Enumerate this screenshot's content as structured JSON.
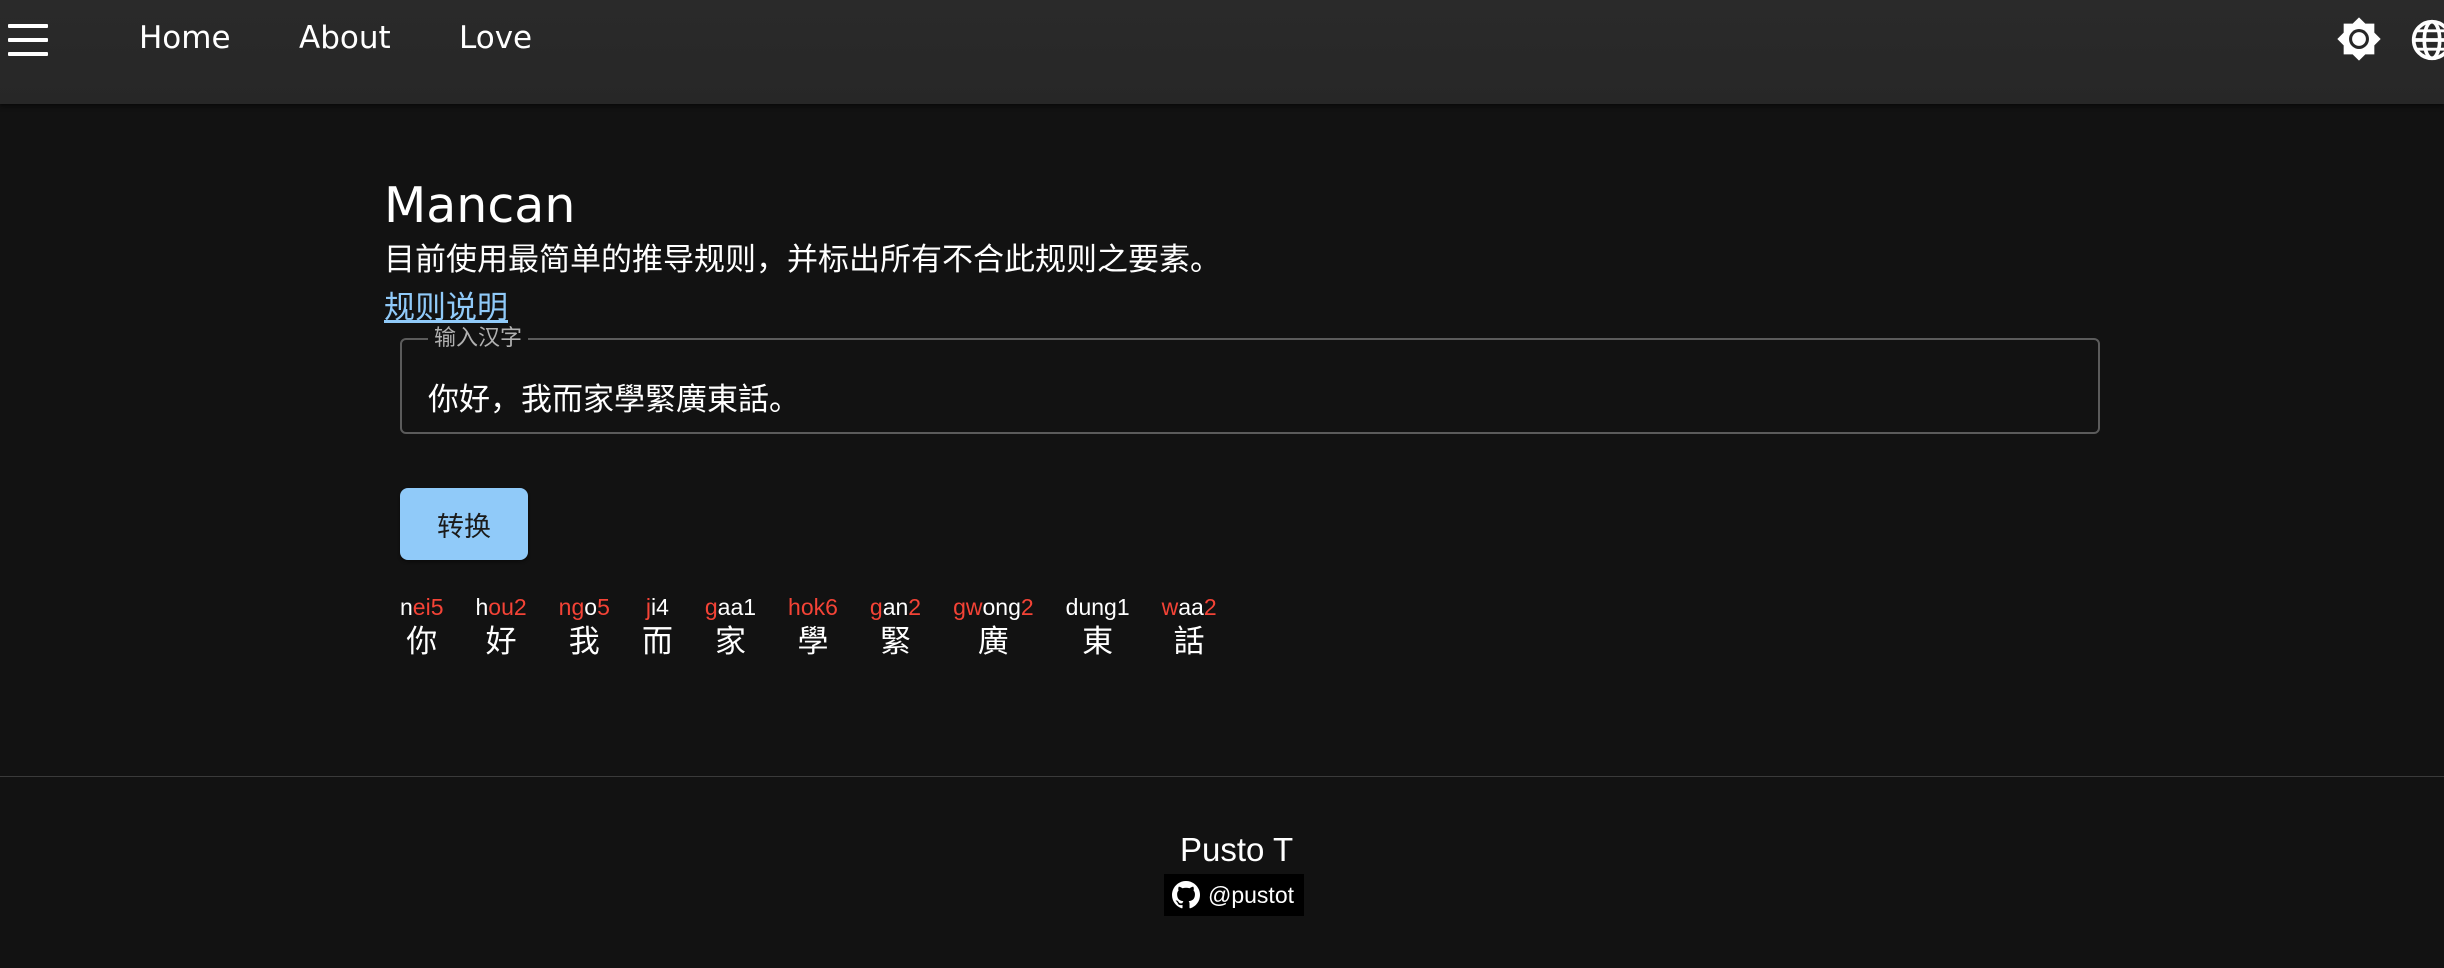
{
  "nav": {
    "items": [
      "Home",
      "About",
      "Love"
    ]
  },
  "icons": {
    "menu": "hamburger-menu-icon",
    "theme": "brightness-icon",
    "language": "globe-icon",
    "github": "github-icon"
  },
  "page": {
    "title": "Mancan",
    "description": "目前使用最简单的推导规则，并标出所有不合此规则之要素。",
    "rule_link": "规则说明"
  },
  "input": {
    "legend": "输入汉字",
    "value": "你好，我而家學緊廣東話。"
  },
  "convert_label": "转换",
  "result": [
    {
      "char": "你",
      "parts": [
        {
          "t": "n",
          "red": false
        },
        {
          "t": "ei5",
          "red": true
        }
      ]
    },
    {
      "char": "好",
      "parts": [
        {
          "t": "h",
          "red": false
        },
        {
          "t": "ou2",
          "red": true
        }
      ]
    },
    {
      "char": "我",
      "parts": [
        {
          "t": "ng",
          "red": true
        },
        {
          "t": "o",
          "red": false
        },
        {
          "t": "5",
          "red": true
        }
      ]
    },
    {
      "char": "而",
      "parts": [
        {
          "t": "j",
          "red": true
        },
        {
          "t": "i4",
          "red": false
        }
      ]
    },
    {
      "char": "家",
      "parts": [
        {
          "t": "g",
          "red": true
        },
        {
          "t": "aa1",
          "red": false
        }
      ]
    },
    {
      "char": "學",
      "parts": [
        {
          "t": "hok6",
          "red": true
        }
      ]
    },
    {
      "char": "緊",
      "parts": [
        {
          "t": "g",
          "red": true
        },
        {
          "t": "an",
          "red": false
        },
        {
          "t": "2",
          "red": true
        }
      ]
    },
    {
      "char": "廣",
      "parts": [
        {
          "t": "gw",
          "red": true
        },
        {
          "t": "ong",
          "red": false
        },
        {
          "t": "2",
          "red": true
        }
      ]
    },
    {
      "char": "東",
      "parts": [
        {
          "t": "dung1",
          "red": false
        }
      ]
    },
    {
      "char": "話",
      "parts": [
        {
          "t": "w",
          "red": true
        },
        {
          "t": "aa",
          "red": false
        },
        {
          "t": "2",
          "red": true
        }
      ]
    }
  ],
  "footer": {
    "author": "Pusto T",
    "github_handle": "@pustot"
  },
  "colors": {
    "background": "#121212",
    "appbar": "#272727",
    "accent": "#90caf9",
    "mismatch": "#f44336"
  }
}
